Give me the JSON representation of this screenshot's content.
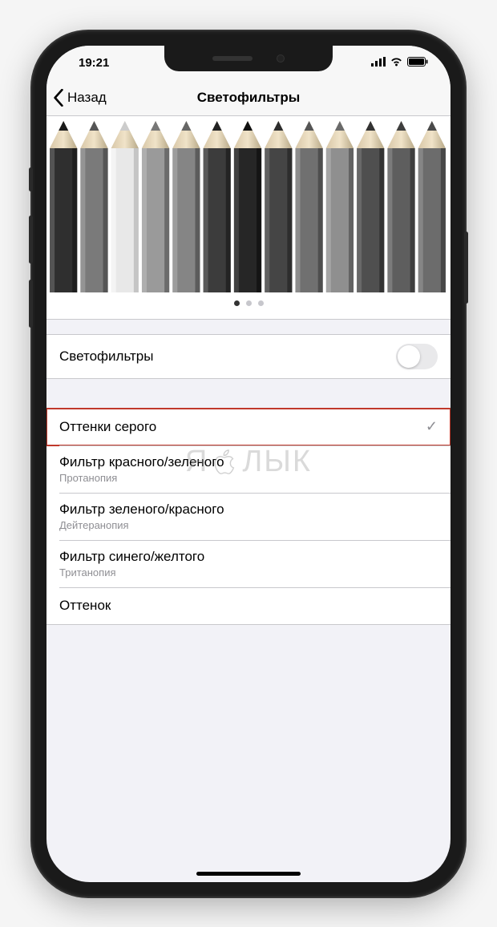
{
  "statusbar": {
    "time": "19:21"
  },
  "nav": {
    "back": "Назад",
    "title": "Светофильтры"
  },
  "toggle_row": {
    "label": "Светофильтры",
    "enabled": false
  },
  "filters": [
    {
      "label": "Оттенки серого",
      "sub": null,
      "selected": true
    },
    {
      "label": "Фильтр красного/зеленого",
      "sub": "Протанопия",
      "selected": false
    },
    {
      "label": "Фильтр зеленого/красного",
      "sub": "Дейтеранопия",
      "selected": false
    },
    {
      "label": "Фильтр синего/желтого",
      "sub": "Тританопия",
      "selected": false
    },
    {
      "label": "Оттенок",
      "sub": null,
      "selected": false
    }
  ],
  "watermark": "ЯБЛЫК",
  "pager": {
    "pages": 3,
    "active": 0
  }
}
